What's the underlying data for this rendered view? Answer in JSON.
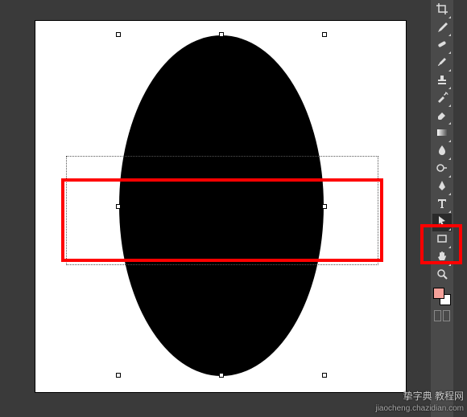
{
  "canvas": {
    "shapes": {
      "ellipse": {
        "fill": "#000000"
      },
      "selection": {
        "present": true
      },
      "marquee_rect": {
        "present": true
      }
    },
    "highlight_rect": {
      "color": "#ff0000"
    }
  },
  "colors": {
    "foreground": "#f5a19a",
    "background": "#ffffff"
  },
  "toolbar": {
    "highlight_color": "#ff0000",
    "tools": [
      {
        "name": "crop-tool"
      },
      {
        "name": "eyedropper-tool"
      },
      {
        "name": "healing-brush-tool"
      },
      {
        "name": "brush-tool"
      },
      {
        "name": "clone-stamp-tool"
      },
      {
        "name": "history-brush-tool"
      },
      {
        "name": "eraser-tool"
      },
      {
        "name": "gradient-tool"
      },
      {
        "name": "blur-tool"
      },
      {
        "name": "dodge-tool"
      },
      {
        "name": "pen-tool"
      },
      {
        "name": "type-tool"
      },
      {
        "name": "path-selection-tool"
      },
      {
        "name": "shape-tool"
      },
      {
        "name": "hand-tool"
      },
      {
        "name": "zoom-tool"
      }
    ]
  },
  "watermark": {
    "text": "挚字典 教程网",
    "url": "jiaocheng.chazidian.com"
  }
}
